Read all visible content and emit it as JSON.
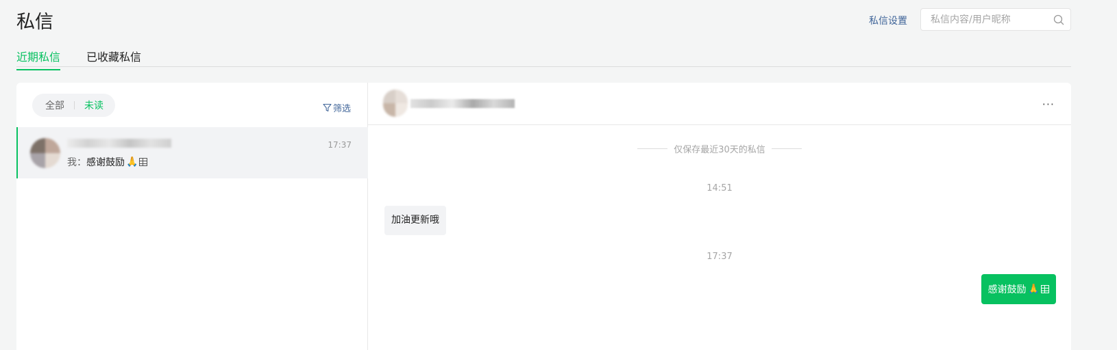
{
  "header": {
    "title": "私信",
    "settings_link": "私信设置",
    "search_placeholder": "私信内容/用户昵称"
  },
  "tabs": [
    {
      "label": "近期私信",
      "active": true
    },
    {
      "label": "已收藏私信",
      "active": false
    }
  ],
  "filters": {
    "all": "全部",
    "unread": "未读",
    "active": "unread",
    "screen_label": "筛选"
  },
  "conversations": [
    {
      "time": "17:37",
      "preview_prefix": "我：",
      "preview_text": "感谢鼓励",
      "preview_emoji": "🙏"
    }
  ],
  "chat": {
    "more_label": "···",
    "save_notice": "仅保存最近30天的私信",
    "messages": [
      {
        "timestamp": "14:51",
        "direction": "received",
        "text": "加油更新哦"
      },
      {
        "timestamp": "17:37",
        "direction": "sent",
        "text": "感谢鼓励",
        "emoji": "🙏"
      }
    ]
  },
  "colors": {
    "accent": "#07c160",
    "link": "#406599",
    "background": "#f4f5f5"
  }
}
